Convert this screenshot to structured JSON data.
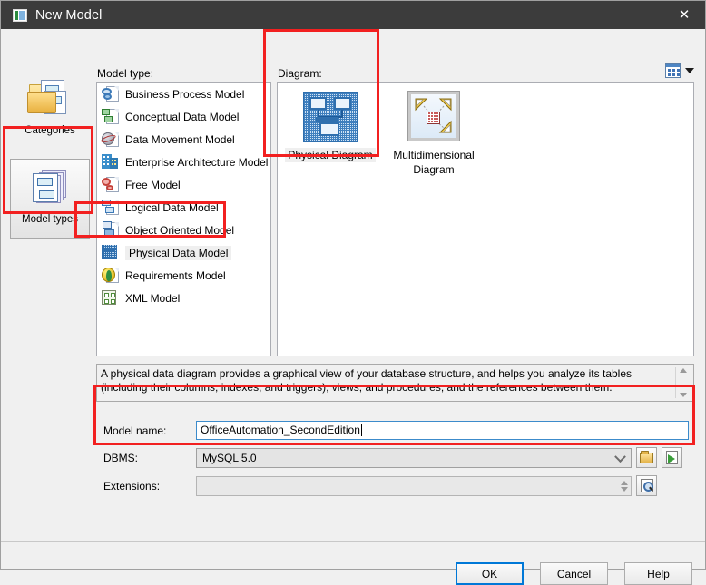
{
  "window": {
    "title": "New Model",
    "icon": "app-window-icon",
    "close_label": "✕"
  },
  "rail": {
    "items": [
      {
        "label": "Categories",
        "icon": "categories-icon",
        "selected": false
      },
      {
        "label": "Model types",
        "icon": "model-types-icon",
        "selected": true
      }
    ]
  },
  "labels": {
    "model_type": "Model type:",
    "diagram": "Diagram:"
  },
  "model_types": [
    {
      "label": "Business Process Model",
      "icon": "business-process-model-icon",
      "selected": false
    },
    {
      "label": "Conceptual Data Model",
      "icon": "conceptual-data-model-icon",
      "selected": false
    },
    {
      "label": "Data Movement Model",
      "icon": "data-movement-model-icon",
      "selected": false
    },
    {
      "label": "Enterprise Architecture Model",
      "icon": "enterprise-architecture-model-icon",
      "selected": false
    },
    {
      "label": "Free Model",
      "icon": "free-model-icon",
      "selected": false
    },
    {
      "label": "Logical Data Model",
      "icon": "logical-data-model-icon",
      "selected": false
    },
    {
      "label": "Object Oriented Model",
      "icon": "object-oriented-model-icon",
      "selected": false
    },
    {
      "label": "Physical Data Model",
      "icon": "physical-data-model-icon",
      "selected": true
    },
    {
      "label": "Requirements Model",
      "icon": "requirements-model-icon",
      "selected": false
    },
    {
      "label": "XML Model",
      "icon": "xml-model-icon",
      "selected": false
    }
  ],
  "diagrams": [
    {
      "label": "Physical Diagram",
      "icon": "physical-diagram-icon",
      "selected": true
    },
    {
      "label": "Multidimensional Diagram",
      "label_line1": "Multidimensional",
      "label_line2": "Diagram",
      "icon": "multidimensional-diagram-icon",
      "selected": false
    }
  ],
  "view_toggle": {
    "icon": "view-style-grid-icon",
    "caret": "chevron-down-icon"
  },
  "description": {
    "text": "A physical data diagram provides a graphical view of your database structure, and helps you analyze its tables (including their columns, indexes, and triggers), views, and procedures, and the references between them."
  },
  "form": {
    "model_name": {
      "label": "Model name:",
      "value": "OfficeAutomation_SecondEdition",
      "placeholder": ""
    },
    "dbms": {
      "label": "DBMS:",
      "value": "MySQL 5.0",
      "browse_icon": "folder-open-icon",
      "export_icon": "share-export-icon"
    },
    "extensions": {
      "label": "Extensions:",
      "value": "",
      "placeholder": "",
      "browse_icon": "magnifier-preview-icon"
    }
  },
  "buttons": {
    "ok": "OK",
    "cancel": "Cancel",
    "help": "Help"
  },
  "annotations": {
    "highlight_color": "#f22020",
    "boxes": [
      {
        "name": "model-types-rail-highlight"
      },
      {
        "name": "physical-data-model-highlight"
      },
      {
        "name": "diagram-panel-highlight"
      },
      {
        "name": "model-name-dbms-highlight"
      }
    ]
  },
  "colors": {
    "titlebar_bg": "#3c3c3c",
    "dialog_bg": "#f0f0f0",
    "accent_blue": "#0078d7",
    "selection_gray": "#efefef"
  }
}
